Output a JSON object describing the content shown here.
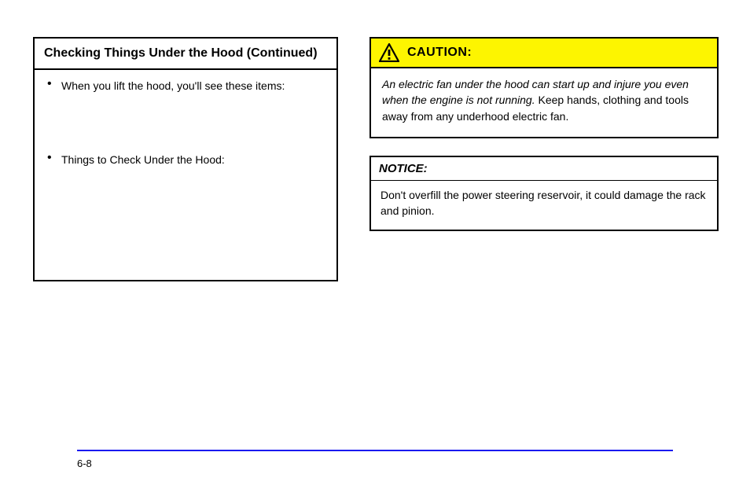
{
  "important": {
    "header": "Checking Things Under the Hood (Continued)",
    "bullets": [
      "When you lift the hood, you'll see these items:",
      "Things to Check Under the Hood:"
    ]
  },
  "caution": {
    "label": "CAUTION:",
    "body_lead": "An electric fan under the hood can start up and injure you even when the engine is not running. ",
    "body_rest": "Keep hands, clothing and tools away from any underhood electric fan."
  },
  "notice": {
    "header": "NOTICE:",
    "body": "Don't overfill the power steering reservoir, it could damage the rack and pinion."
  },
  "page_number": "6-8"
}
